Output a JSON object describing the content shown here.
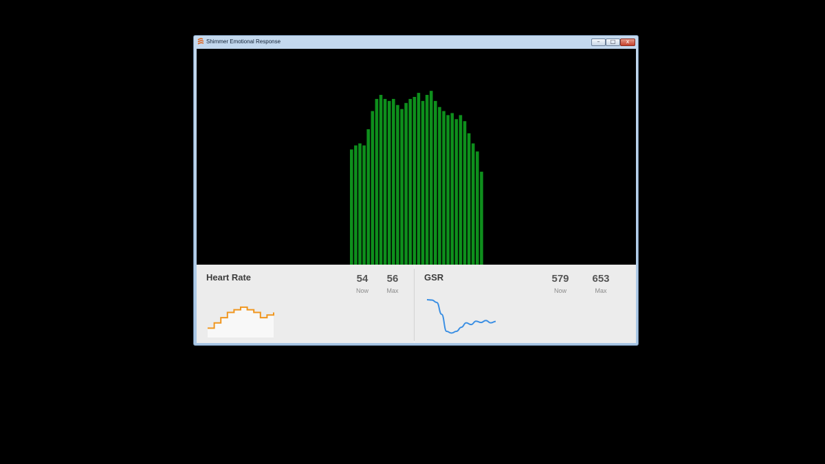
{
  "window": {
    "title": "Shimmer Emotional Response"
  },
  "controls": {
    "minimize": "–",
    "maximize": "□",
    "close": "x"
  },
  "colors": {
    "bars": "#0e8f1c",
    "heart_rate_line": "#f0961e",
    "gsr_line": "#3b8fe3",
    "panel_bg": "#ececec"
  },
  "chart_data": {
    "type": "bar",
    "values": [
      57,
      59,
      60,
      59,
      67,
      76,
      82,
      84,
      82,
      81,
      82,
      79,
      77,
      80,
      82,
      83,
      85,
      81,
      84,
      86,
      81,
      78,
      76,
      74,
      75,
      72,
      74,
      71,
      65,
      60,
      56,
      46
    ],
    "ylim": [
      0,
      100
    ]
  },
  "heart_rate": {
    "label": "Heart Rate",
    "now": "54",
    "now_label": "Now",
    "max": "56",
    "max_label": "Max",
    "history": [
      48,
      48,
      50,
      50,
      52,
      52,
      54,
      54,
      55,
      55,
      56,
      56,
      55,
      55,
      54,
      54,
      52,
      52,
      53,
      53,
      54
    ]
  },
  "gsr": {
    "label": "GSR",
    "now": "579",
    "now_label": "Now",
    "max": "653",
    "max_label": "Max",
    "history": [
      653,
      652,
      645,
      610,
      560,
      555,
      560,
      572,
      585,
      580,
      590,
      586,
      592,
      585,
      589
    ]
  }
}
